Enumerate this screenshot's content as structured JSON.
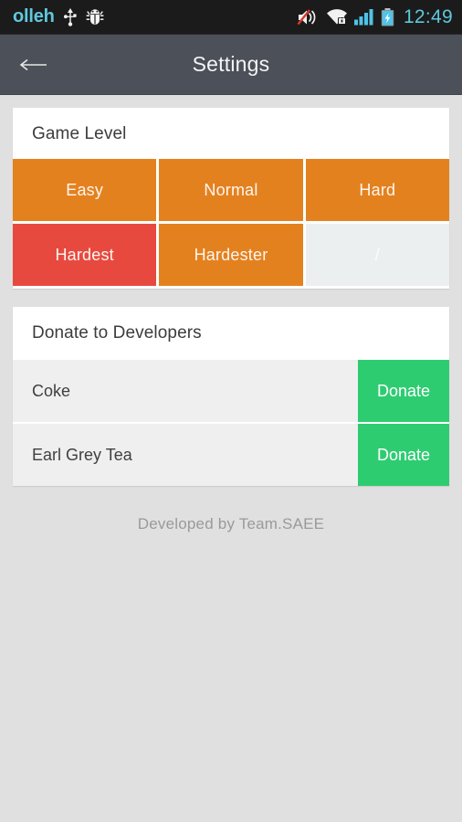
{
  "status_bar": {
    "carrier": "olleh",
    "time": "12:49",
    "icons": [
      "usb-icon",
      "android-debug-bug-icon",
      "volume-muted-icon",
      "wifi-secure-icon",
      "signal-bars-icon",
      "battery-charging-icon"
    ],
    "carrier_color": "#5FC8DC",
    "background": "#1B1B1B"
  },
  "appbar": {
    "title": "Settings",
    "back_label": "←",
    "background": "#4B5059"
  },
  "game_level": {
    "title": "Game Level",
    "cells": [
      {
        "label": "Easy",
        "state": "normal",
        "color": "#E4811F"
      },
      {
        "label": "Normal",
        "state": "normal",
        "color": "#E4811F"
      },
      {
        "label": "Hard",
        "state": "normal",
        "color": "#E4811F"
      },
      {
        "label": "Hardest",
        "state": "selected",
        "color": "#E8493F"
      },
      {
        "label": "Hardester",
        "state": "normal",
        "color": "#E4811F"
      },
      {
        "label": "/",
        "state": "empty",
        "color": "#ECEFEF"
      }
    ]
  },
  "donate": {
    "title": "Donate to Developers",
    "button_color": "#2ECC71",
    "items": [
      {
        "name": "Coke",
        "button": "Donate"
      },
      {
        "name": "Earl Grey Tea",
        "button": "Donate"
      }
    ]
  },
  "footer": {
    "text": "Developed by Team.SAEE"
  }
}
